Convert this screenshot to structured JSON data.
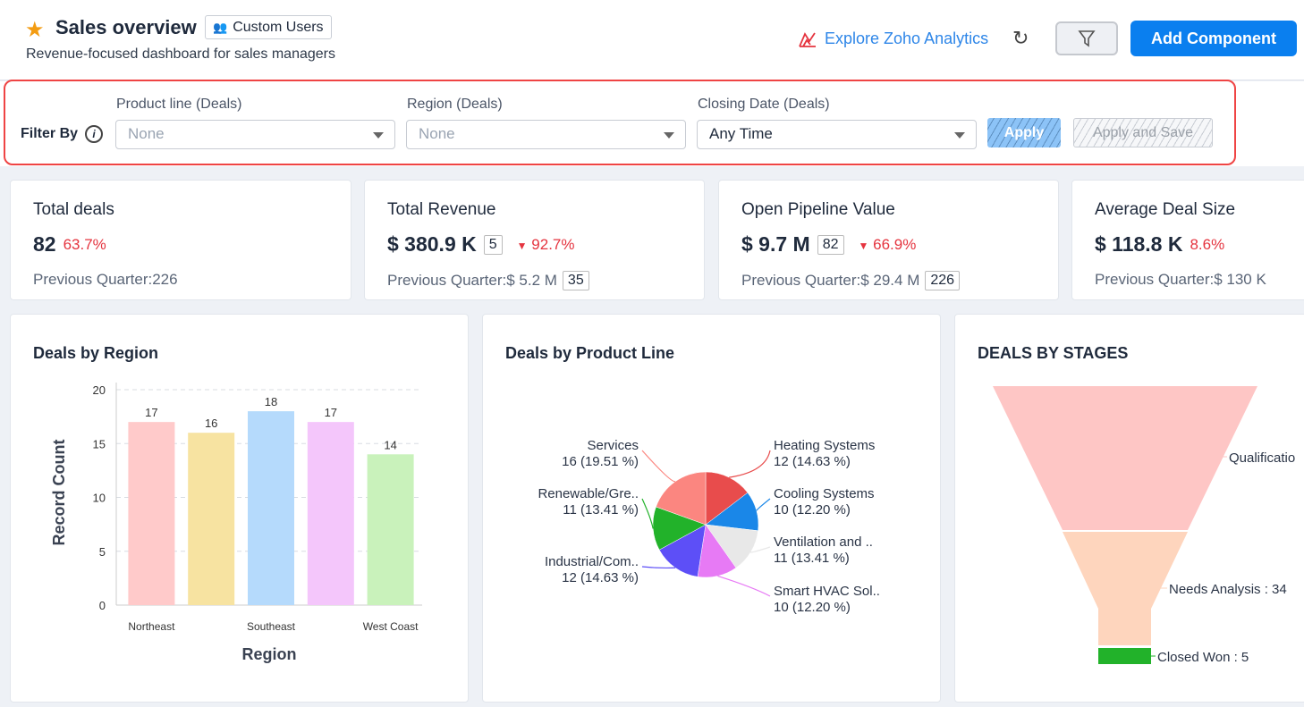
{
  "header": {
    "title": "Sales overview",
    "badge": "Custom Users",
    "subtitle": "Revenue-focused dashboard for sales managers",
    "explore": "Explore Zoho Analytics",
    "add_component": "Add Component"
  },
  "filters": {
    "label": "Filter By",
    "fields": [
      {
        "label": "Product line (Deals)",
        "value": "None"
      },
      {
        "label": "Region (Deals)",
        "value": "None"
      },
      {
        "label": "Closing Date (Deals)",
        "value": "Any Time"
      }
    ],
    "apply": "Apply",
    "apply_save": "Apply and Save"
  },
  "kpis": [
    {
      "title": "Total deals",
      "value": "82",
      "change": "63.7%",
      "direction": "none",
      "prev_label": "Previous Quarter:226"
    },
    {
      "title": "Total Revenue",
      "value": "$ 380.9 K",
      "count": "5",
      "change": "92.7%",
      "direction": "down",
      "prev_label": "Previous Quarter:$ 5.2 M",
      "prev_count": "35"
    },
    {
      "title": "Open Pipeline Value",
      "value": "$ 9.7 M",
      "count": "82",
      "change": "66.9%",
      "direction": "down",
      "prev_label": "Previous Quarter:$ 29.4 M",
      "prev_count": "226"
    },
    {
      "title": "Average Deal Size",
      "value": "$ 118.8 K",
      "change": "8.6%",
      "direction": "none",
      "prev_label": "Previous Quarter:$ 130 K"
    }
  ],
  "chart_data": [
    {
      "type": "bar",
      "title": "Deals by Region",
      "xlabel": "Region",
      "ylabel": "Record Count",
      "ylim": [
        0,
        20
      ],
      "yticks": [
        0,
        5,
        10,
        15,
        20
      ],
      "grid": true,
      "categories": [
        "Northeast",
        "",
        "Southeast",
        "",
        "West Coast"
      ],
      "values": [
        17,
        16,
        18,
        17,
        14
      ],
      "colors": [
        "#ffcaca",
        "#f7e3a1",
        "#b5dafc",
        "#f4c6fb",
        "#c9f2bb"
      ]
    },
    {
      "type": "pie",
      "title": "Deals by Product Line",
      "slices": [
        {
          "label": "Heating Systems",
          "value": 12,
          "pct": "12 (14.63 %)",
          "color": "#e84c4c"
        },
        {
          "label": "Cooling Systems",
          "value": 10,
          "pct": "10 (12.20 %)",
          "color": "#1a87e8"
        },
        {
          "label": "Ventilation and ..",
          "value": 11,
          "pct": "11 (13.41 %)",
          "color": "#e8e8e8"
        },
        {
          "label": "Smart HVAC Sol..",
          "value": 10,
          "pct": "10 (12.20 %)",
          "color": "#e77af5"
        },
        {
          "label": "Industrial/Com..",
          "value": 12,
          "pct": "12 (14.63 %)",
          "color": "#5d4ff7"
        },
        {
          "label": "Renewable/Gre..",
          "value": 11,
          "pct": "11 (13.41 %)",
          "color": "#22b22a"
        },
        {
          "label": "Services",
          "value": 16,
          "pct": "16 (19.51 %)",
          "color": "#fb8680"
        }
      ]
    },
    {
      "type": "funnel",
      "title": "DEALS BY STAGES",
      "stages": [
        {
          "label": "Qualificatio",
          "color": "#fec6c5"
        },
        {
          "label": "Needs Analysis : 34",
          "value": 34,
          "color": "#fed5bd"
        },
        {
          "label": "Closed Won : 5",
          "value": 5,
          "color": "#22b22a"
        }
      ]
    }
  ]
}
